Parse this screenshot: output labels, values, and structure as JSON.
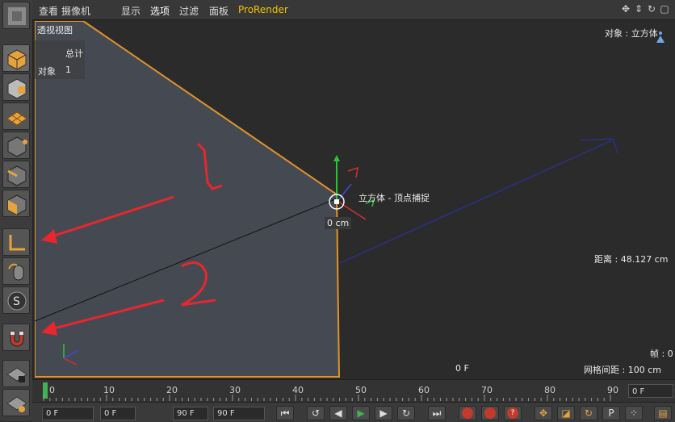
{
  "menu": {
    "items": [
      "查看",
      "摄像机",
      "显示",
      "选项",
      "过滤",
      "面板",
      "ProRender"
    ]
  },
  "viewport": {
    "name": "透视视图",
    "stats_header": "总计",
    "stats_label": "对象",
    "stats_value": "1",
    "selected_object": "对象 : 立方体",
    "snap_label": "立方体 - 顶点捕捉",
    "snap_distance": "0 cm",
    "distance": "距离 : 48.127 cm",
    "frame_center": "0 F",
    "fps": "帧 : 0",
    "grid_spacing": "网格间距 : 100 cm",
    "annotation_1": "1.",
    "annotation_2": "2."
  },
  "timeline": {
    "ticks": [
      "0",
      "10",
      "20",
      "30",
      "40",
      "50",
      "60",
      "70",
      "80",
      "90"
    ],
    "current_frame": "0 F"
  },
  "bottom": {
    "start_frame": "0 F",
    "range_start": "0 F",
    "range_end": "90 F",
    "end_frame": "90 F"
  },
  "colors": {
    "object_face": "#454a52",
    "object_edge": "#e0932a",
    "annotation": "#e8262d",
    "axis_y": "#2fbf3a",
    "axis_x": "#d23030",
    "axis_z": "#3a4bd0",
    "playhead": "#3fb34f"
  },
  "sidebar_icons": [
    "model-mode-icon",
    "texture-mode-icon",
    "workplane-icon",
    "points-mode-icon",
    "edges-mode-icon",
    "polygons-mode-icon",
    "axis-mode-icon",
    "tweak-mode-icon",
    "solo-icon",
    "snap-magnet-icon",
    "lock-workplane-icon",
    "planar-workplane-icon"
  ]
}
